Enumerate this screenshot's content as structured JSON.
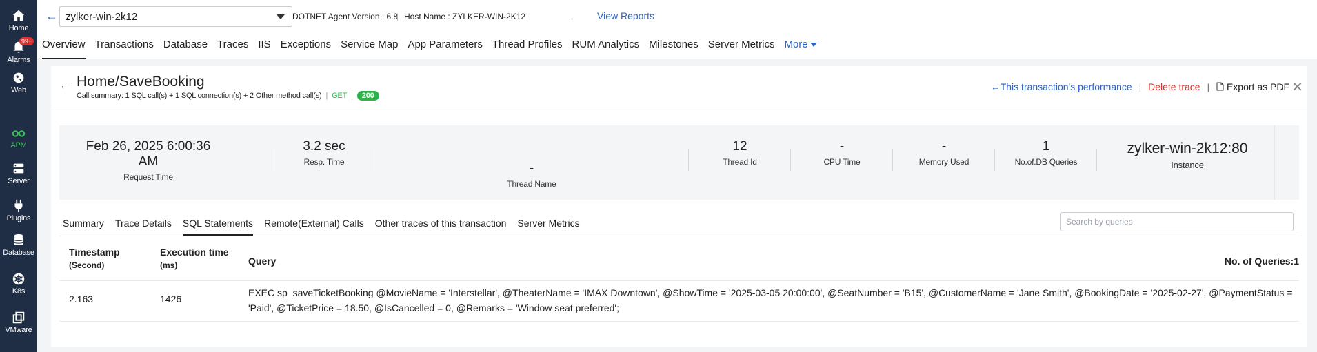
{
  "sidebar": {
    "items": [
      {
        "label": "Home",
        "icon": "home-icon"
      },
      {
        "label": "Alarms",
        "icon": "bell-icon",
        "badge": "99+"
      },
      {
        "label": "Web",
        "icon": "globe-icon"
      },
      {
        "label": "APM",
        "icon": "binoculars-icon"
      },
      {
        "label": "Server",
        "icon": "server-icon"
      },
      {
        "label": "Plugins",
        "icon": "plug-icon"
      },
      {
        "label": "Database",
        "icon": "database-icon"
      },
      {
        "label": "K8s",
        "icon": "kubernetes-icon"
      },
      {
        "label": "VMware",
        "icon": "vmware-icon"
      }
    ]
  },
  "header": {
    "monitor": "zylker-win-2k12",
    "agent_version": "DOTNET Agent Version : 6.8",
    "host_name": "Host Name : ZYLKER-WIN-2K12",
    "dot": ".",
    "view_reports": "View Reports",
    "tabs": [
      "Overview",
      "Transactions",
      "Database",
      "Traces",
      "IIS",
      "Exceptions",
      "Service Map",
      "App Parameters",
      "Thread Profiles",
      "RUM Analytics",
      "Milestones",
      "Server Metrics"
    ],
    "more": "More"
  },
  "trace": {
    "title": "Home/SaveBooking",
    "summary": "Call summary: 1 SQL call(s) + 1 SQL connection(s) + 2 Other method call(s)",
    "method": "GET",
    "status": "200",
    "actions": {
      "performance": "This transaction's performance",
      "delete": "Delete trace",
      "export": "Export as PDF"
    }
  },
  "metrics": {
    "request_time": {
      "value": "Feb 26, 2025 6:00:36 AM",
      "label": "Request Time"
    },
    "resp_time": {
      "value": "3.2 sec",
      "label": "Resp. Time"
    },
    "thread_name": {
      "value": "-",
      "label": "Thread Name"
    },
    "thread_id": {
      "value": "12",
      "label": "Thread Id"
    },
    "cpu_time": {
      "value": "-",
      "label": "CPU Time"
    },
    "memory_used": {
      "value": "-",
      "label": "Memory Used"
    },
    "db_queries": {
      "value": "1",
      "label": "No.of.DB Queries"
    },
    "instance": {
      "value": "zylker-win-2k12:80",
      "label": "Instance"
    }
  },
  "subtabs": [
    "Summary",
    "Trace Details",
    "SQL Statements",
    "Remote(External) Calls",
    "Other traces of this transaction",
    "Server Metrics"
  ],
  "search": {
    "placeholder": "Search by queries"
  },
  "table": {
    "headers": {
      "timestamp": "Timestamp",
      "timestamp_unit": "(Second)",
      "exec_time": "Execution time",
      "exec_unit": "(ms)",
      "query": "Query",
      "count": "No. of Queries:1"
    },
    "rows": [
      {
        "timestamp": "2.163",
        "exec_time": "1426",
        "query": "EXEC sp_saveTicketBooking @MovieName = 'Interstellar', @TheaterName = 'IMAX Downtown', @ShowTime = '2025-03-05 20:00:00', @SeatNumber = 'B15', @CustomerName = 'Jane Smith', @BookingDate = '2025-02-27', @PaymentStatus = 'Paid', @TicketPrice = 18.50, @IsCancelled = 0, @Remarks = 'Window seat preferred';"
      }
    ]
  }
}
